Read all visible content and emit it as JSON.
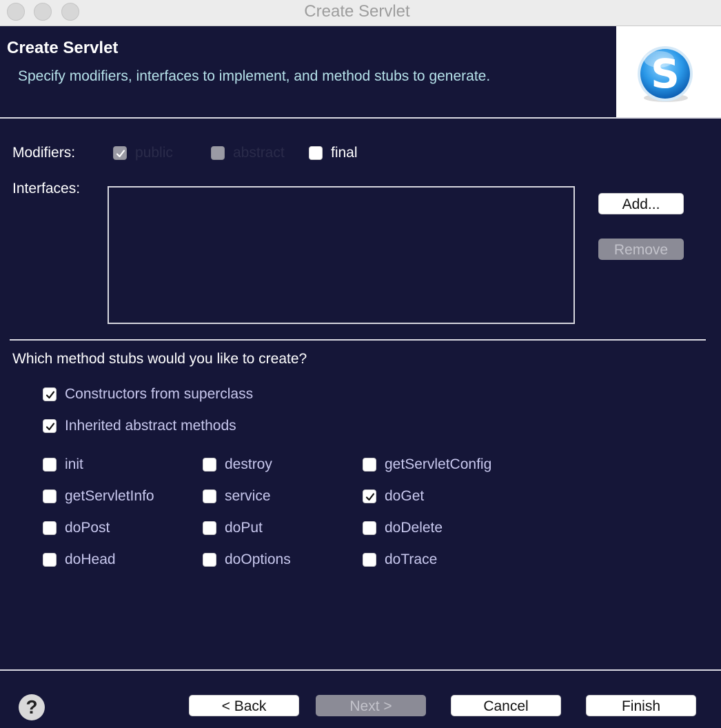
{
  "window": {
    "title": "Create Servlet"
  },
  "header": {
    "title": "Create Servlet",
    "subtitle": "Specify modifiers, interfaces to implement, and method stubs to generate."
  },
  "modifiers": {
    "label": "Modifiers:",
    "options": [
      {
        "label": "public",
        "checked": true,
        "disabled": true
      },
      {
        "label": "abstract",
        "checked": false,
        "disabled": true
      },
      {
        "label": "final",
        "checked": false,
        "disabled": false
      }
    ]
  },
  "interfaces": {
    "label": "Interfaces:",
    "add_label": "Add...",
    "remove_label": "Remove"
  },
  "stubs": {
    "question": "Which method stubs would you like to create?",
    "primary": [
      {
        "label": "Constructors from superclass",
        "checked": true
      },
      {
        "label": "Inherited abstract methods",
        "checked": true
      }
    ],
    "methods": [
      {
        "label": "init",
        "checked": false
      },
      {
        "label": "destroy",
        "checked": false
      },
      {
        "label": "getServletConfig",
        "checked": false
      },
      {
        "label": "getServletInfo",
        "checked": false
      },
      {
        "label": "service",
        "checked": false
      },
      {
        "label": "doGet",
        "checked": true
      },
      {
        "label": "doPost",
        "checked": false
      },
      {
        "label": "doPut",
        "checked": false
      },
      {
        "label": "doDelete",
        "checked": false
      },
      {
        "label": "doHead",
        "checked": false
      },
      {
        "label": "doOptions",
        "checked": false
      },
      {
        "label": "doTrace",
        "checked": false
      }
    ]
  },
  "footer": {
    "help_glyph": "?",
    "back_label": "< Back",
    "next_label": "Next >",
    "cancel_label": "Cancel",
    "finish_label": "Finish"
  },
  "colors": {
    "background": "#151638",
    "subtitle": "#b6e2ea",
    "checkbox_label": "#c8c8ee",
    "logo_blue": "#1e8fe0"
  }
}
